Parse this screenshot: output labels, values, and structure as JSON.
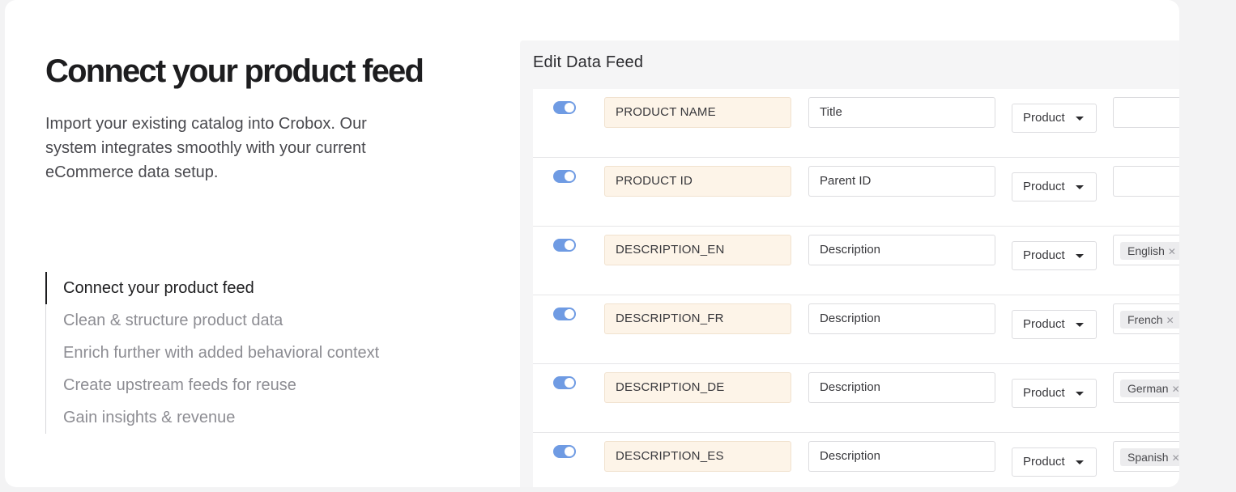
{
  "hero": {
    "title": "Connect your product feed",
    "description": "Import your existing catalog into Crobox. Our system integrates smoothly with your current eCommerce data setup."
  },
  "steps": [
    {
      "label": "Connect your product feed",
      "active": true
    },
    {
      "label": "Clean & structure product data",
      "active": false
    },
    {
      "label": "Enrich further with added behavioral context",
      "active": false
    },
    {
      "label": "Create upstream feeds for reuse",
      "active": false
    },
    {
      "label": "Gain insights & revenue",
      "active": false
    }
  ],
  "panel": {
    "title": "Edit Data Feed",
    "rows": [
      {
        "enabled": true,
        "field": "PRODUCT NAME",
        "mapping": "Title",
        "type": "Product",
        "language": ""
      },
      {
        "enabled": true,
        "field": "PRODUCT ID",
        "mapping": "Parent ID",
        "type": "Product",
        "language": ""
      },
      {
        "enabled": true,
        "field": "DESCRIPTION_EN",
        "mapping": "Description",
        "type": "Product",
        "language": "English"
      },
      {
        "enabled": true,
        "field": "DESCRIPTION_FR",
        "mapping": "Description",
        "type": "Product",
        "language": "French"
      },
      {
        "enabled": true,
        "field": "DESCRIPTION_DE",
        "mapping": "Description",
        "type": "Product",
        "language": "German"
      },
      {
        "enabled": true,
        "field": "DESCRIPTION_ES",
        "mapping": "Description",
        "type": "Product",
        "language": "Spanish"
      }
    ]
  },
  "colors": {
    "toggle_on": "#6f9be3",
    "field_name_bg": "#fdf4e8",
    "active_step": "#1d1d1f",
    "inactive_step": "#8d8d93"
  }
}
